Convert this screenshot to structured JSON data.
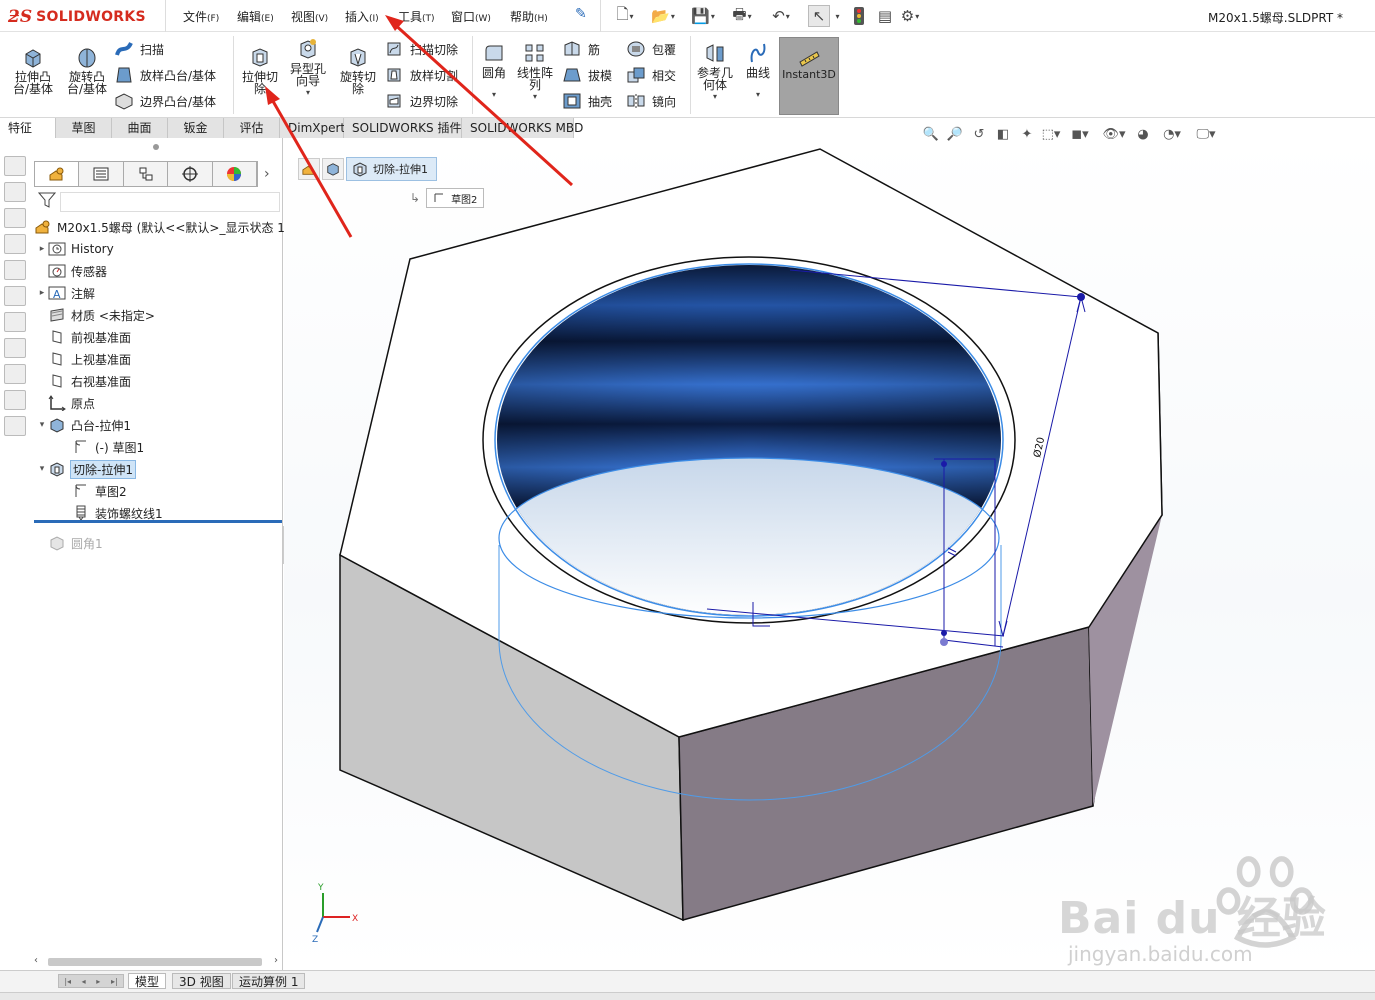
{
  "app": {
    "logo_ds": "ƻS",
    "logo_text": "SOLIDWORKS",
    "document_title": "M20x1.5螺母.SLDPRT *"
  },
  "menu": [
    {
      "label": "文件",
      "key": "(F)"
    },
    {
      "label": "编辑",
      "key": "(E)"
    },
    {
      "label": "视图",
      "key": "(V)"
    },
    {
      "label": "插入",
      "key": "(I)"
    },
    {
      "label": "工具",
      "key": "(T)"
    },
    {
      "label": "窗口",
      "key": "(W)"
    },
    {
      "label": "帮助",
      "key": "(H)"
    }
  ],
  "ribbon": {
    "extrude_boss": "拉伸凸台/基体",
    "revolve_boss": "旋转凸台/基体",
    "sweep": "扫描",
    "loft_boss": "放样凸台/基体",
    "boundary_boss": "边界凸台/基体",
    "extrude_cut": "拉伸切除",
    "hole_wizard": "异型孔向导",
    "revolve_cut": "旋转切除",
    "sweep_cut": "扫描切除",
    "loft_cut": "放样切割",
    "boundary_cut": "边界切除",
    "fillet": "圆角",
    "linear_pattern": "线性阵列",
    "rib": "筋",
    "draft": "拔模",
    "shell": "抽壳",
    "wrap": "包覆",
    "intersect": "相交",
    "mirror": "镜向",
    "ref_geometry": "参考几何体",
    "curves": "曲线",
    "instant3d": "Instant3D"
  },
  "tabs": [
    "特征",
    "草图",
    "曲面",
    "钣金",
    "评估",
    "DimXpert",
    "SOLIDWORKS 插件",
    "SOLIDWORKS MBD"
  ],
  "tree": {
    "root": "M20x1.5螺母 (默认<<默认>_显示状态 1",
    "nodes": [
      {
        "label": "History",
        "indent": 1,
        "expander": "▸"
      },
      {
        "label": "传感器",
        "indent": 1,
        "expander": ""
      },
      {
        "label": "注解",
        "indent": 1,
        "expander": "▸"
      },
      {
        "label": "材质 <未指定>",
        "indent": 1,
        "expander": ""
      },
      {
        "label": "前视基准面",
        "indent": 1,
        "expander": ""
      },
      {
        "label": "上视基准面",
        "indent": 1,
        "expander": ""
      },
      {
        "label": "右视基准面",
        "indent": 1,
        "expander": ""
      },
      {
        "label": "原点",
        "indent": 1,
        "expander": ""
      },
      {
        "label": "凸台-拉伸1",
        "indent": 1,
        "expander": "▾"
      },
      {
        "label": "(-) 草图1",
        "indent": 2,
        "expander": ""
      },
      {
        "label": "切除-拉伸1",
        "indent": 1,
        "expander": "▾"
      },
      {
        "label": "草图2",
        "indent": 2,
        "expander": ""
      },
      {
        "label": "装饰螺纹线1",
        "indent": 2,
        "expander": ""
      },
      {
        "label": "圆角1",
        "indent": 1,
        "expander": ""
      }
    ]
  },
  "breadcrumb": {
    "feature": "切除-拉伸1",
    "sketch": "草图2"
  },
  "viewport": {
    "dimension": "Ø20",
    "triad_x": "X",
    "triad_y": "Y",
    "triad_z": "Z"
  },
  "bottom_tabs": [
    "模型",
    "3D 视图",
    "运动算例 1"
  ],
  "watermark": {
    "brand": "Bai du 经验",
    "url": "jingyan.baidu.com"
  },
  "colors": {
    "accent": "#2a6bb8",
    "logo": "#d52b1e",
    "annotation_arrow": "#e0251b",
    "selection": "#cfe4f7"
  }
}
